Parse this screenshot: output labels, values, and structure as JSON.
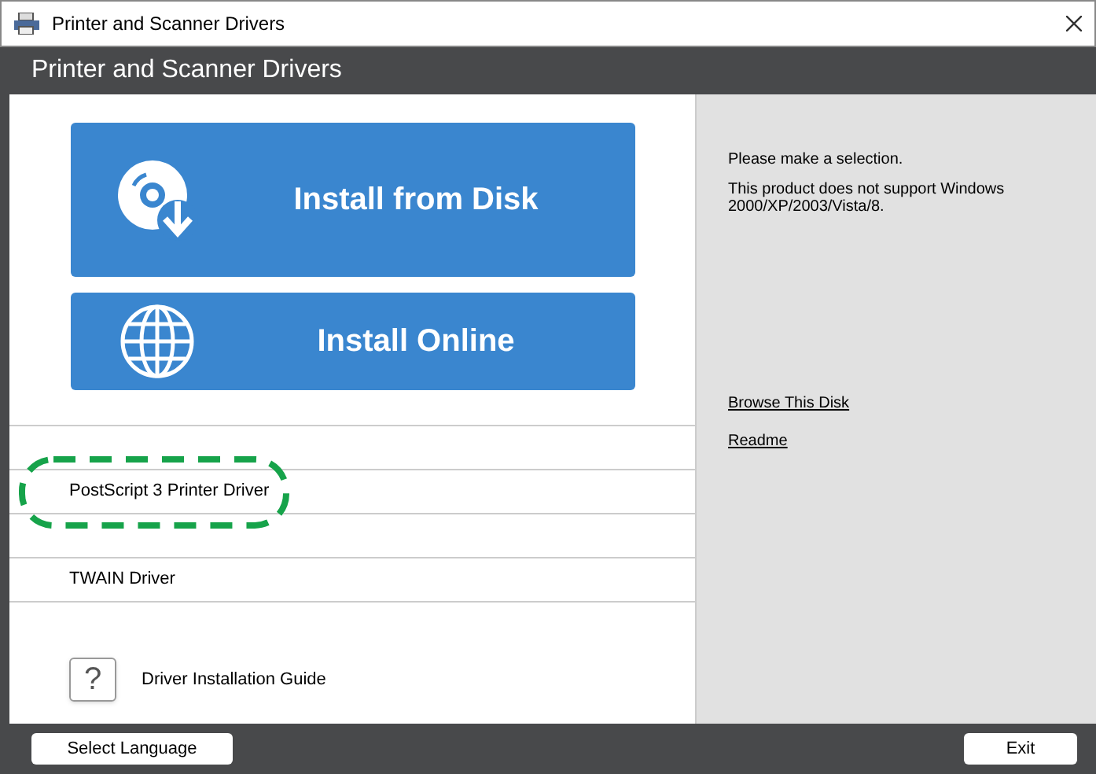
{
  "window": {
    "title": "Printer and Scanner Drivers"
  },
  "header": {
    "title": "Printer and Scanner Drivers"
  },
  "actions": [
    {
      "kind": "disk",
      "label": "Install from Disk"
    },
    {
      "kind": "online",
      "label": "Install Online"
    }
  ],
  "drivers": [
    {
      "highlighted": false
    },
    {
      "label": "PostScript 3 Printer Driver",
      "highlighted": true
    },
    {
      "highlighted": false
    },
    {
      "label": "TWAIN Driver",
      "highlighted": false
    }
  ],
  "guide": {
    "icon": "?",
    "label": "Driver Installation Guide"
  },
  "info": {
    "messages": [
      "Please make a selection.",
      "This product does not support Windows 2000/XP/2003/Vista/8."
    ],
    "links": [
      "Browse This Disk",
      "Readme"
    ]
  },
  "footer": {
    "left_button": "Select Language",
    "right_button": "Exit"
  }
}
